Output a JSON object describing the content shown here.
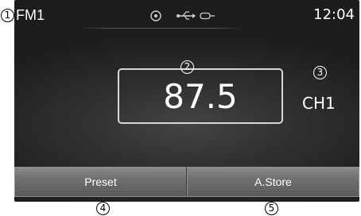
{
  "header": {
    "source": "FM1",
    "time": "12:04",
    "status_icons": [
      "disc-icon",
      "usb-icon",
      "aux-input-icon"
    ]
  },
  "tuner": {
    "frequency": "87.5",
    "channel": "CH1"
  },
  "buttons": {
    "preset": "Preset",
    "auto_store": "A.Store"
  },
  "callouts": [
    "1",
    "2",
    "3",
    "4",
    "5"
  ]
}
